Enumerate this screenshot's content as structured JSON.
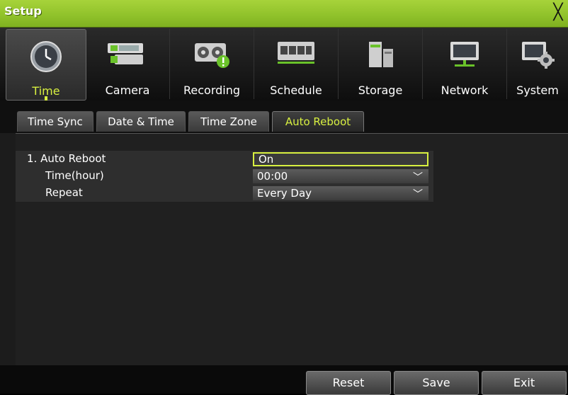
{
  "window": {
    "title": "Setup",
    "close_glyph": "╳"
  },
  "toolbar": {
    "items": [
      {
        "label": "Time",
        "icon": "clock-icon",
        "active": true
      },
      {
        "label": "Camera",
        "icon": "camera-icon",
        "active": false
      },
      {
        "label": "Recording",
        "icon": "recording-icon",
        "active": false
      },
      {
        "label": "Schedule",
        "icon": "schedule-icon",
        "active": false
      },
      {
        "label": "Storage",
        "icon": "storage-icon",
        "active": false
      },
      {
        "label": "Network",
        "icon": "network-icon",
        "active": false
      },
      {
        "label": "System",
        "icon": "system-icon",
        "active": false
      }
    ]
  },
  "tabs": [
    {
      "label": "Time Sync",
      "active": false
    },
    {
      "label": "Date & Time",
      "active": false
    },
    {
      "label": "Time Zone",
      "active": false
    },
    {
      "label": "Auto Reboot",
      "active": true
    }
  ],
  "settings": {
    "auto_reboot": {
      "label": "1. Auto Reboot",
      "value": "On"
    },
    "time_hour": {
      "label": "Time(hour)",
      "value": "00:00"
    },
    "repeat": {
      "label": "Repeat",
      "value": "Every Day"
    }
  },
  "footer": {
    "reset_label": "Reset",
    "save_label": "Save",
    "exit_label": "Exit"
  },
  "colors": {
    "accent": "#d8f040",
    "titlebar": "#8fc12a"
  }
}
